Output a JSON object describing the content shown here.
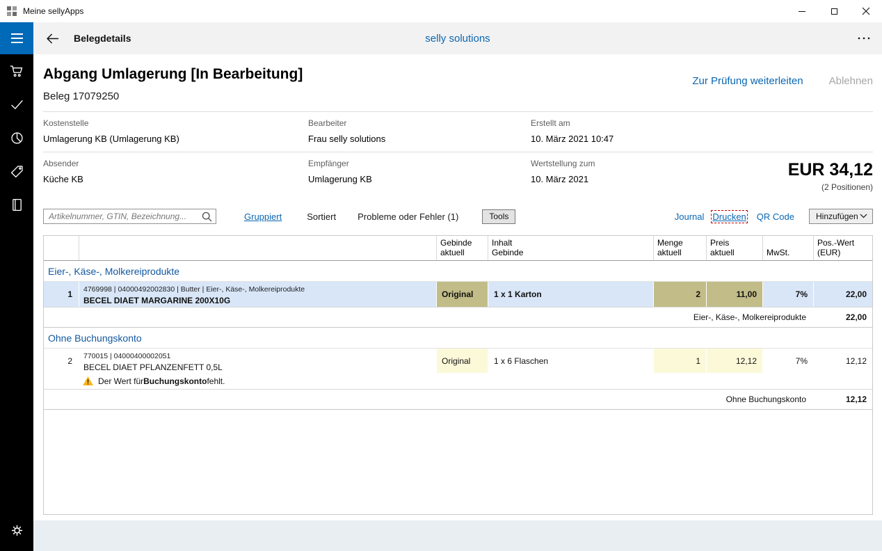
{
  "titlebar": {
    "title": "Meine sellyApps"
  },
  "header": {
    "title": "Belegdetails",
    "app_name": "selly solutions"
  },
  "sidebar": {
    "items": [
      "hamburger-menu",
      "shopping-cart",
      "checkmark",
      "pie-chart",
      "price-tag",
      "book",
      "gear"
    ]
  },
  "doc": {
    "title": "Abgang Umlagerung [In Bearbeitung]",
    "beleg": "Beleg 17079250",
    "action_forward": "Zur Prüfung weiterleiten",
    "action_reject": "Ablehnen",
    "fields": {
      "kostenstelle_label": "Kostenstelle",
      "kostenstelle_value": "Umlagerung KB (Umlagerung KB)",
      "bearbeiter_label": "Bearbeiter",
      "bearbeiter_value": "Frau selly solutions",
      "erstellt_label": "Erstellt am",
      "erstellt_value": "10. März 2021 10:47",
      "absender_label": "Absender",
      "absender_value": "Küche KB",
      "empfaenger_label": "Empfänger",
      "empfaenger_value": "Umlagerung KB",
      "wertstellung_label": "Wertstellung zum",
      "wertstellung_value": "10. März 2021"
    },
    "total": "EUR 34,12",
    "total_positions": "(2 Positionen)"
  },
  "toolbar": {
    "search_placeholder": "Artikelnummer, GTIN, Bezeichnung...",
    "gruppiert": "Gruppiert",
    "sortiert": "Sortiert",
    "probleme": "Probleme oder Fehler (1)",
    "tools": "Tools",
    "journal": "Journal",
    "drucken": "Drucken",
    "qrcode": "QR Code",
    "hinzufuegen": "Hinzufügen"
  },
  "table": {
    "headers": {
      "col_gebinde": "Gebinde\naktuell",
      "col_inhalt": "Inhalt\nGebinde",
      "col_menge": "Menge\naktuell",
      "col_preis": "Preis\naktuell",
      "col_mwst": "MwSt.",
      "col_wert": "Pos.-Wert\n(EUR)"
    },
    "groups": [
      {
        "name": "Eier-, Käse-, Molkereiprodukte",
        "rows": [
          {
            "num": "1",
            "meta": "4769998 | 04000492002830 | Butter | Eier-, Käse-, Molkereiprodukte",
            "name": "BECEL DIAET MARGARINE 200X10G",
            "gebinde": "Original",
            "inhalt": "1 x 1 Karton",
            "menge": "2",
            "preis": "11,00",
            "mwst": "7%",
            "wert": "22,00"
          }
        ],
        "subtotal_label": "Eier-, Käse-, Molkereiprodukte",
        "subtotal_value": "22,00"
      },
      {
        "name": "Ohne Buchungskonto",
        "rows": [
          {
            "num": "2",
            "meta": "770015 | 04000400002051",
            "name": "BECEL DIAET PFLANZENFETT 0,5L",
            "gebinde": "Original",
            "inhalt": "1 x 6 Flaschen",
            "menge": "1",
            "preis": "12,12",
            "mwst": "7%",
            "wert": "12,12",
            "warning_prefix": "Der Wert für ",
            "warning_bold": "Buchungskonto",
            "warning_suffix": " fehlt."
          }
        ],
        "subtotal_label": "Ohne Buchungskonto",
        "subtotal_value": "12,12"
      }
    ]
  },
  "icons": {
    "menu": "hamburger",
    "cart": "shopping-cart",
    "approve": "checkmark",
    "stats": "pie-chart",
    "tags": "price-tag",
    "journal": "book",
    "settings": "gear",
    "search": "magnifier",
    "warning": "triangle-exclamation",
    "dropdown": "chevron-down",
    "back": "arrow-left",
    "more": "ellipsis"
  },
  "colors": {
    "accent_blue": "#0a66b2",
    "menu_blue": "#0069b8",
    "selected_row": "#d8e6f7",
    "changed_cell": "#c2bd88",
    "editable_cell": "#fcf9d9",
    "warning_yellow": "#fcb61a",
    "sidebar_black": "#000000",
    "footer_gray": "#e9eef3"
  }
}
